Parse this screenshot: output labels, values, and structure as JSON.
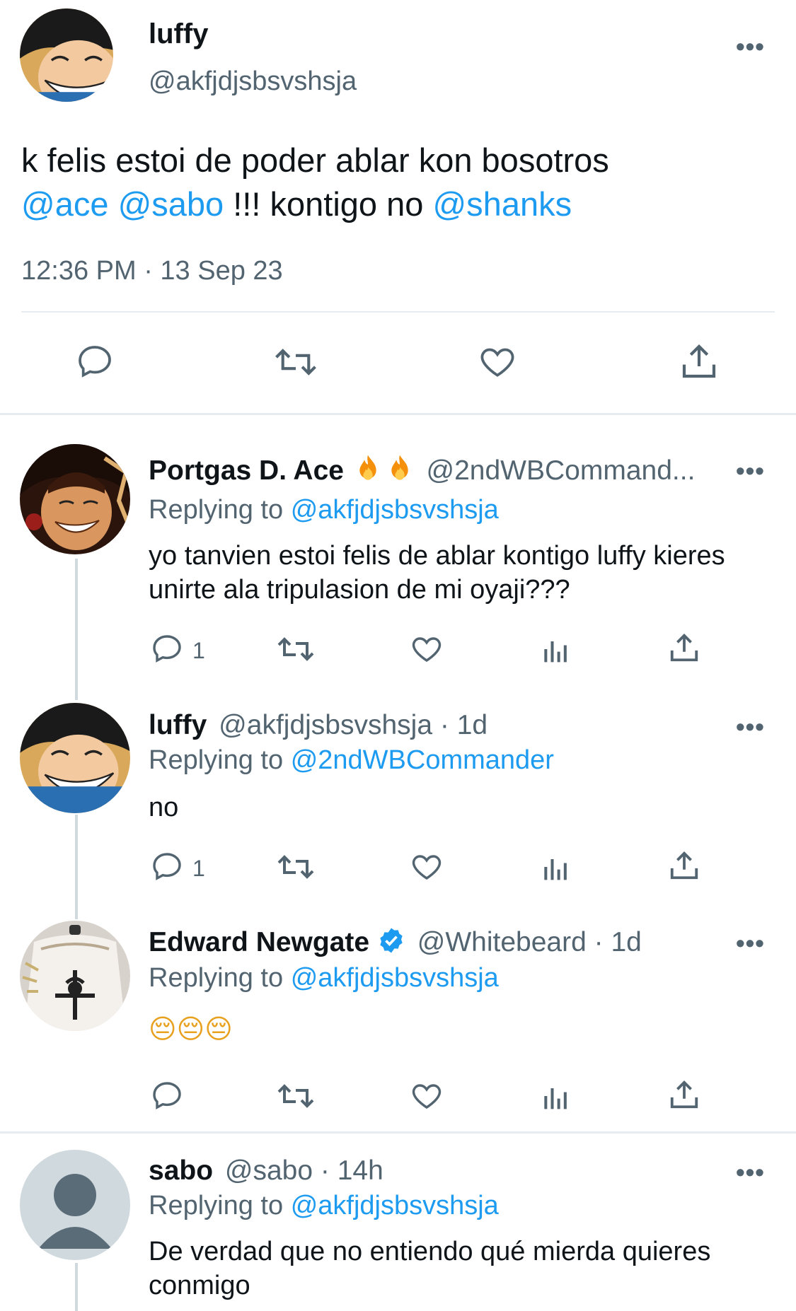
{
  "main_tweet": {
    "name": "luffy",
    "handle": "@akfjdjsbsvshsja",
    "text_line1": "k felis estoi de poder ablar kon bosotros",
    "mention_ace": "@ace",
    "mention_sabo": "@sabo",
    "text_mid": "!!! kontigo no",
    "mention_shanks": "@shanks",
    "timestamp": "12:36 PM · 13 Sep 23",
    "more": "•••"
  },
  "replies": [
    {
      "name": "Portgas D. Ace",
      "handle": "@2ndWBCommand...",
      "replying_label": "Replying to",
      "replying_to": "@akfjdjsbsvshsja",
      "text": "yo tanvien estoi felis de ablar kontigo luffy kieres unirte ala tripulasion de mi oyaji???",
      "reply_count": "1",
      "more": "•••"
    },
    {
      "name": "luffy",
      "handle": "@akfjdjsbsvshsja · 1d",
      "replying_label": "Replying to",
      "replying_to": "@2ndWBCommander",
      "text": "no",
      "reply_count": "1",
      "more": "•••"
    },
    {
      "name": "Edward Newgate",
      "handle": "@Whitebeard · 1d",
      "replying_label": "Replying to",
      "replying_to": "@akfjdjsbsvshsja",
      "text": "😔😔😔",
      "reply_count": "",
      "more": "•••"
    },
    {
      "name": "sabo",
      "handle": "@sabo · 14h",
      "replying_label": "Replying to",
      "replying_to": "@akfjdjsbsvshsja",
      "text": "De verdad que no entiendo qué mierda quieres conmigo",
      "more": "•••"
    }
  ],
  "colors": {
    "link": "#1d9bf0",
    "secondary_text": "#536471",
    "divider": "#e6ecf0",
    "verified": "#1d9bf0",
    "fire": "#f4900c"
  }
}
